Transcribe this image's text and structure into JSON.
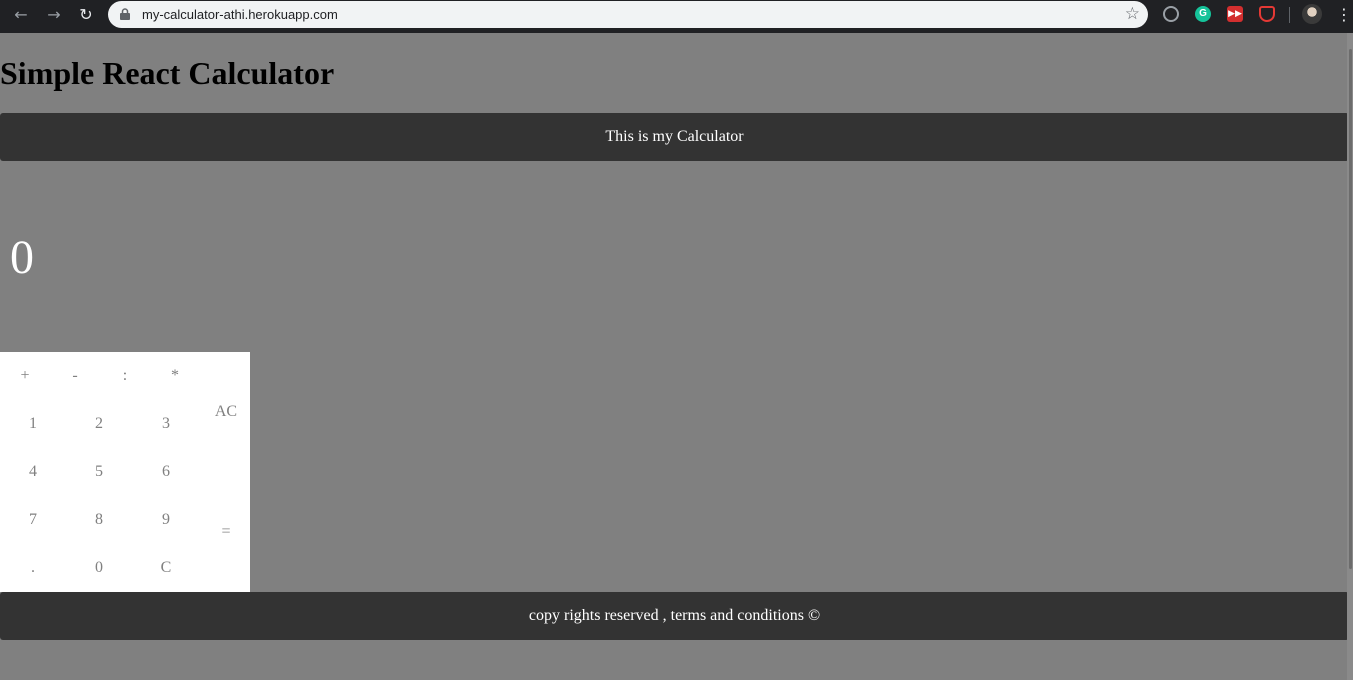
{
  "browser": {
    "url": "my-calculator-athi.herokuapp.com",
    "back_icon": "←",
    "forward_icon": "→",
    "reload_icon": "↻",
    "star_icon": "☆",
    "menu_icon": "⋮",
    "extension_g_label": "G",
    "extension_ff_label": "▶▶"
  },
  "page": {
    "title": "Simple React Calculator",
    "header_text": "This is my Calculator",
    "display_value": "0",
    "footer_text": "copy rights reserved , terms and conditions ©"
  },
  "keypad": {
    "operators": [
      "+",
      "-",
      ":",
      "*"
    ],
    "rows": [
      [
        "1",
        "2",
        "3"
      ],
      [
        "4",
        "5",
        "6"
      ],
      [
        "7",
        "8",
        "9"
      ],
      [
        ".",
        "0",
        "C"
      ]
    ],
    "clear_all": "AC",
    "equals": "="
  },
  "colors": {
    "page_background": "#808080",
    "bar_background": "#333333",
    "keypad_background": "#ffffff",
    "key_text": "#808080"
  }
}
